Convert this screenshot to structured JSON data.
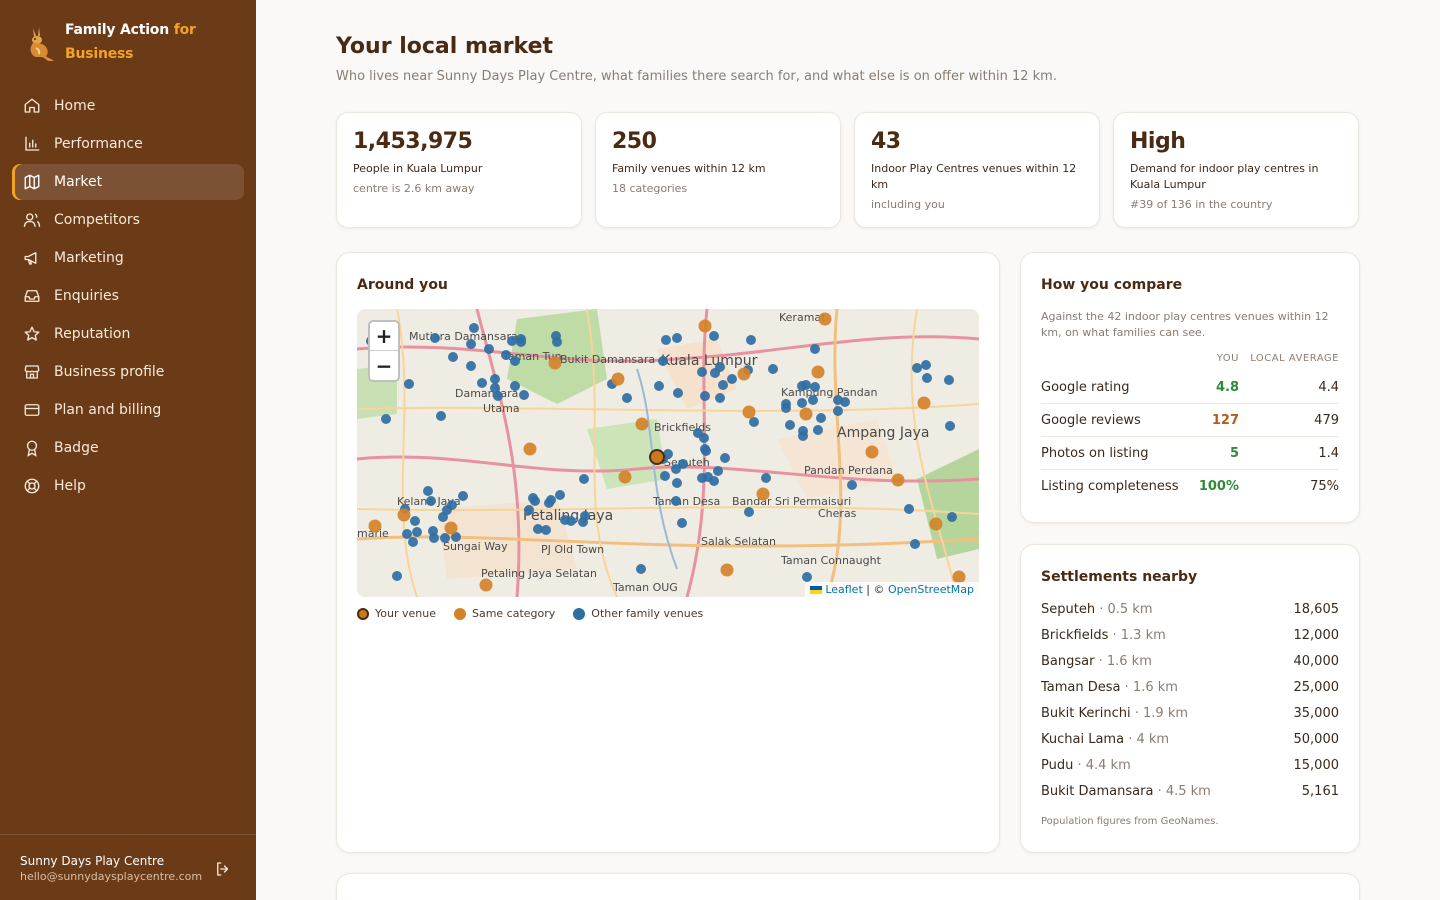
{
  "brand": {
    "line1_white": "Family Action",
    "line1_orange": "for",
    "line2": "Business"
  },
  "nav": [
    {
      "label": "Home",
      "icon": "home-icon"
    },
    {
      "label": "Performance",
      "icon": "bar-chart-icon"
    },
    {
      "label": "Market",
      "icon": "map-icon",
      "active": true
    },
    {
      "label": "Competitors",
      "icon": "users-icon"
    },
    {
      "label": "Marketing",
      "icon": "megaphone-icon"
    },
    {
      "label": "Enquiries",
      "icon": "inbox-icon"
    },
    {
      "label": "Reputation",
      "icon": "star-icon"
    },
    {
      "label": "Business profile",
      "icon": "store-icon"
    },
    {
      "label": "Plan and billing",
      "icon": "credit-card-icon"
    },
    {
      "label": "Badge",
      "icon": "award-icon"
    },
    {
      "label": "Help",
      "icon": "lifebuoy-icon"
    }
  ],
  "account": {
    "name": "Sunny Days Play Centre",
    "email": "hello@sunnydaysplaycentre.com"
  },
  "page": {
    "title": "Your local market",
    "subtitle": "Who lives near Sunny Days Play Centre, what families there search for, and what else is on offer within 12 km."
  },
  "stats": [
    {
      "value": "1,453,975",
      "label": "People in Kuala Lumpur",
      "note": "centre is 2.6 km away"
    },
    {
      "value": "250",
      "label": "Family venues within 12 km",
      "note": "18 categories"
    },
    {
      "value": "43",
      "label": "Indoor Play Centres venues within 12 km",
      "note": "including you"
    },
    {
      "value": "High",
      "label": "Demand for indoor play centres in Kuala Lumpur",
      "note": "#39 of 136 in the country"
    }
  ],
  "map": {
    "title": "Around you",
    "zoom_in": "+",
    "zoom_out": "−",
    "attribution_leaflet": "Leaflet",
    "attribution_sep": " | © ",
    "attribution_osm": "OpenStreetMap",
    "labels": [
      "Keramat",
      "Mutiara Damansara",
      "Taman Tun",
      "Bukit Damansara",
      "Kuala Lumpur",
      "Kampung Pandan",
      "Damansara",
      "Utama",
      "Brickfields",
      "Ampang Jaya",
      "Seputeh",
      "Pandan Perdana",
      "Kelana Jaya",
      "Taman Desa",
      "Bandar Sri Permaisuri",
      "Petaling Jaya",
      "Cheras",
      "PJ Old Town",
      "Salak Selatan",
      "Sungai Way",
      "Taman Connaught",
      "Petaling Jaya Selatan",
      "Taman OUG",
      "marie"
    ],
    "legend": {
      "you": "Your venue",
      "same": "Same category",
      "other": "Other family venues"
    },
    "colors": {
      "you": "#c97a1c",
      "same": "#d4822a",
      "other": "#2f6ea3"
    }
  },
  "compare": {
    "title": "How you compare",
    "desc": "Against the 42 indoor play centres venues within 12 km, on what families can see.",
    "col_you": "YOU",
    "col_avg": "LOCAL AVERAGE",
    "rows": [
      {
        "label": "Google rating",
        "you": "4.8",
        "avg": "4.4",
        "status": "good"
      },
      {
        "label": "Google reviews",
        "you": "127",
        "avg": "479",
        "status": "bad"
      },
      {
        "label": "Photos on listing",
        "you": "5",
        "avg": "1.4",
        "status": "good"
      },
      {
        "label": "Listing completeness",
        "you": "100%",
        "avg": "75%",
        "status": "good"
      }
    ]
  },
  "settlements": {
    "title": "Settlements nearby",
    "rows": [
      {
        "name": "Seputeh",
        "dist": "0.5 km",
        "pop": "18,605"
      },
      {
        "name": "Brickfields",
        "dist": "1.3 km",
        "pop": "12,000"
      },
      {
        "name": "Bangsar",
        "dist": "1.6 km",
        "pop": "40,000"
      },
      {
        "name": "Taman Desa",
        "dist": "1.6 km",
        "pop": "25,000"
      },
      {
        "name": "Bukit Kerinchi",
        "dist": "1.9 km",
        "pop": "35,000"
      },
      {
        "name": "Kuchai Lama",
        "dist": "4 km",
        "pop": "50,000"
      },
      {
        "name": "Pudu",
        "dist": "4.4 km",
        "pop": "15,000"
      },
      {
        "name": "Bukit Damansara",
        "dist": "4.5 km",
        "pop": "5,161"
      }
    ],
    "note": "Population figures from GeoNames."
  }
}
